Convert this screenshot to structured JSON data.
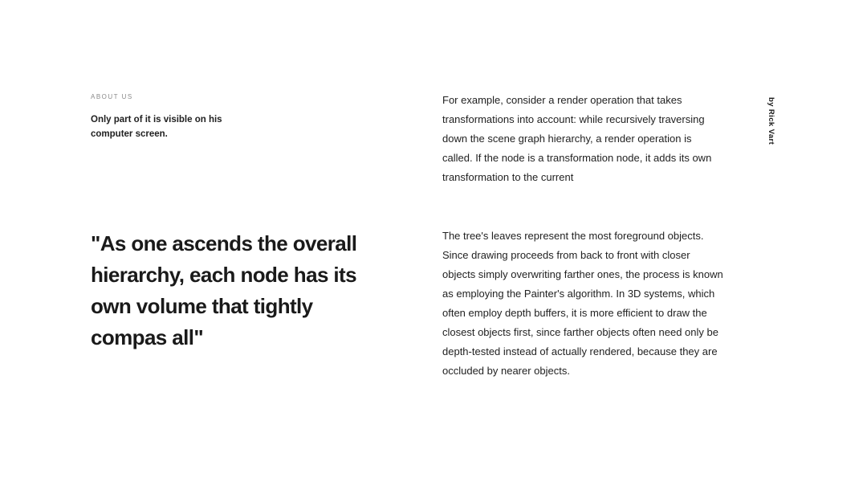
{
  "section": {
    "eyebrow": "ABOUT US",
    "intro": "Only part of it is visible on his computer screen."
  },
  "quote": {
    "text": "\"As one ascends the overall hierarchy, each node has its own volume that tightly compas all\""
  },
  "paragraphs": {
    "first": "For example, consider a render operation that takes transformations into account: while recursively traversing down the scene graph hierarchy, a render operation is called. If the node is a transformation node, it adds its own transformation to the current",
    "second": "The tree's leaves represent the most foreground objects. Since drawing proceeds from back to front with closer objects simply overwriting farther ones, the process is known as employing the Painter's algorithm. In 3D systems, which often employ depth buffers, it is more efficient to draw the closest objects first, since farther objects often need only be depth-tested instead of actually rendered, because they are occluded by nearer objects."
  },
  "byline": "by Rick Vart"
}
